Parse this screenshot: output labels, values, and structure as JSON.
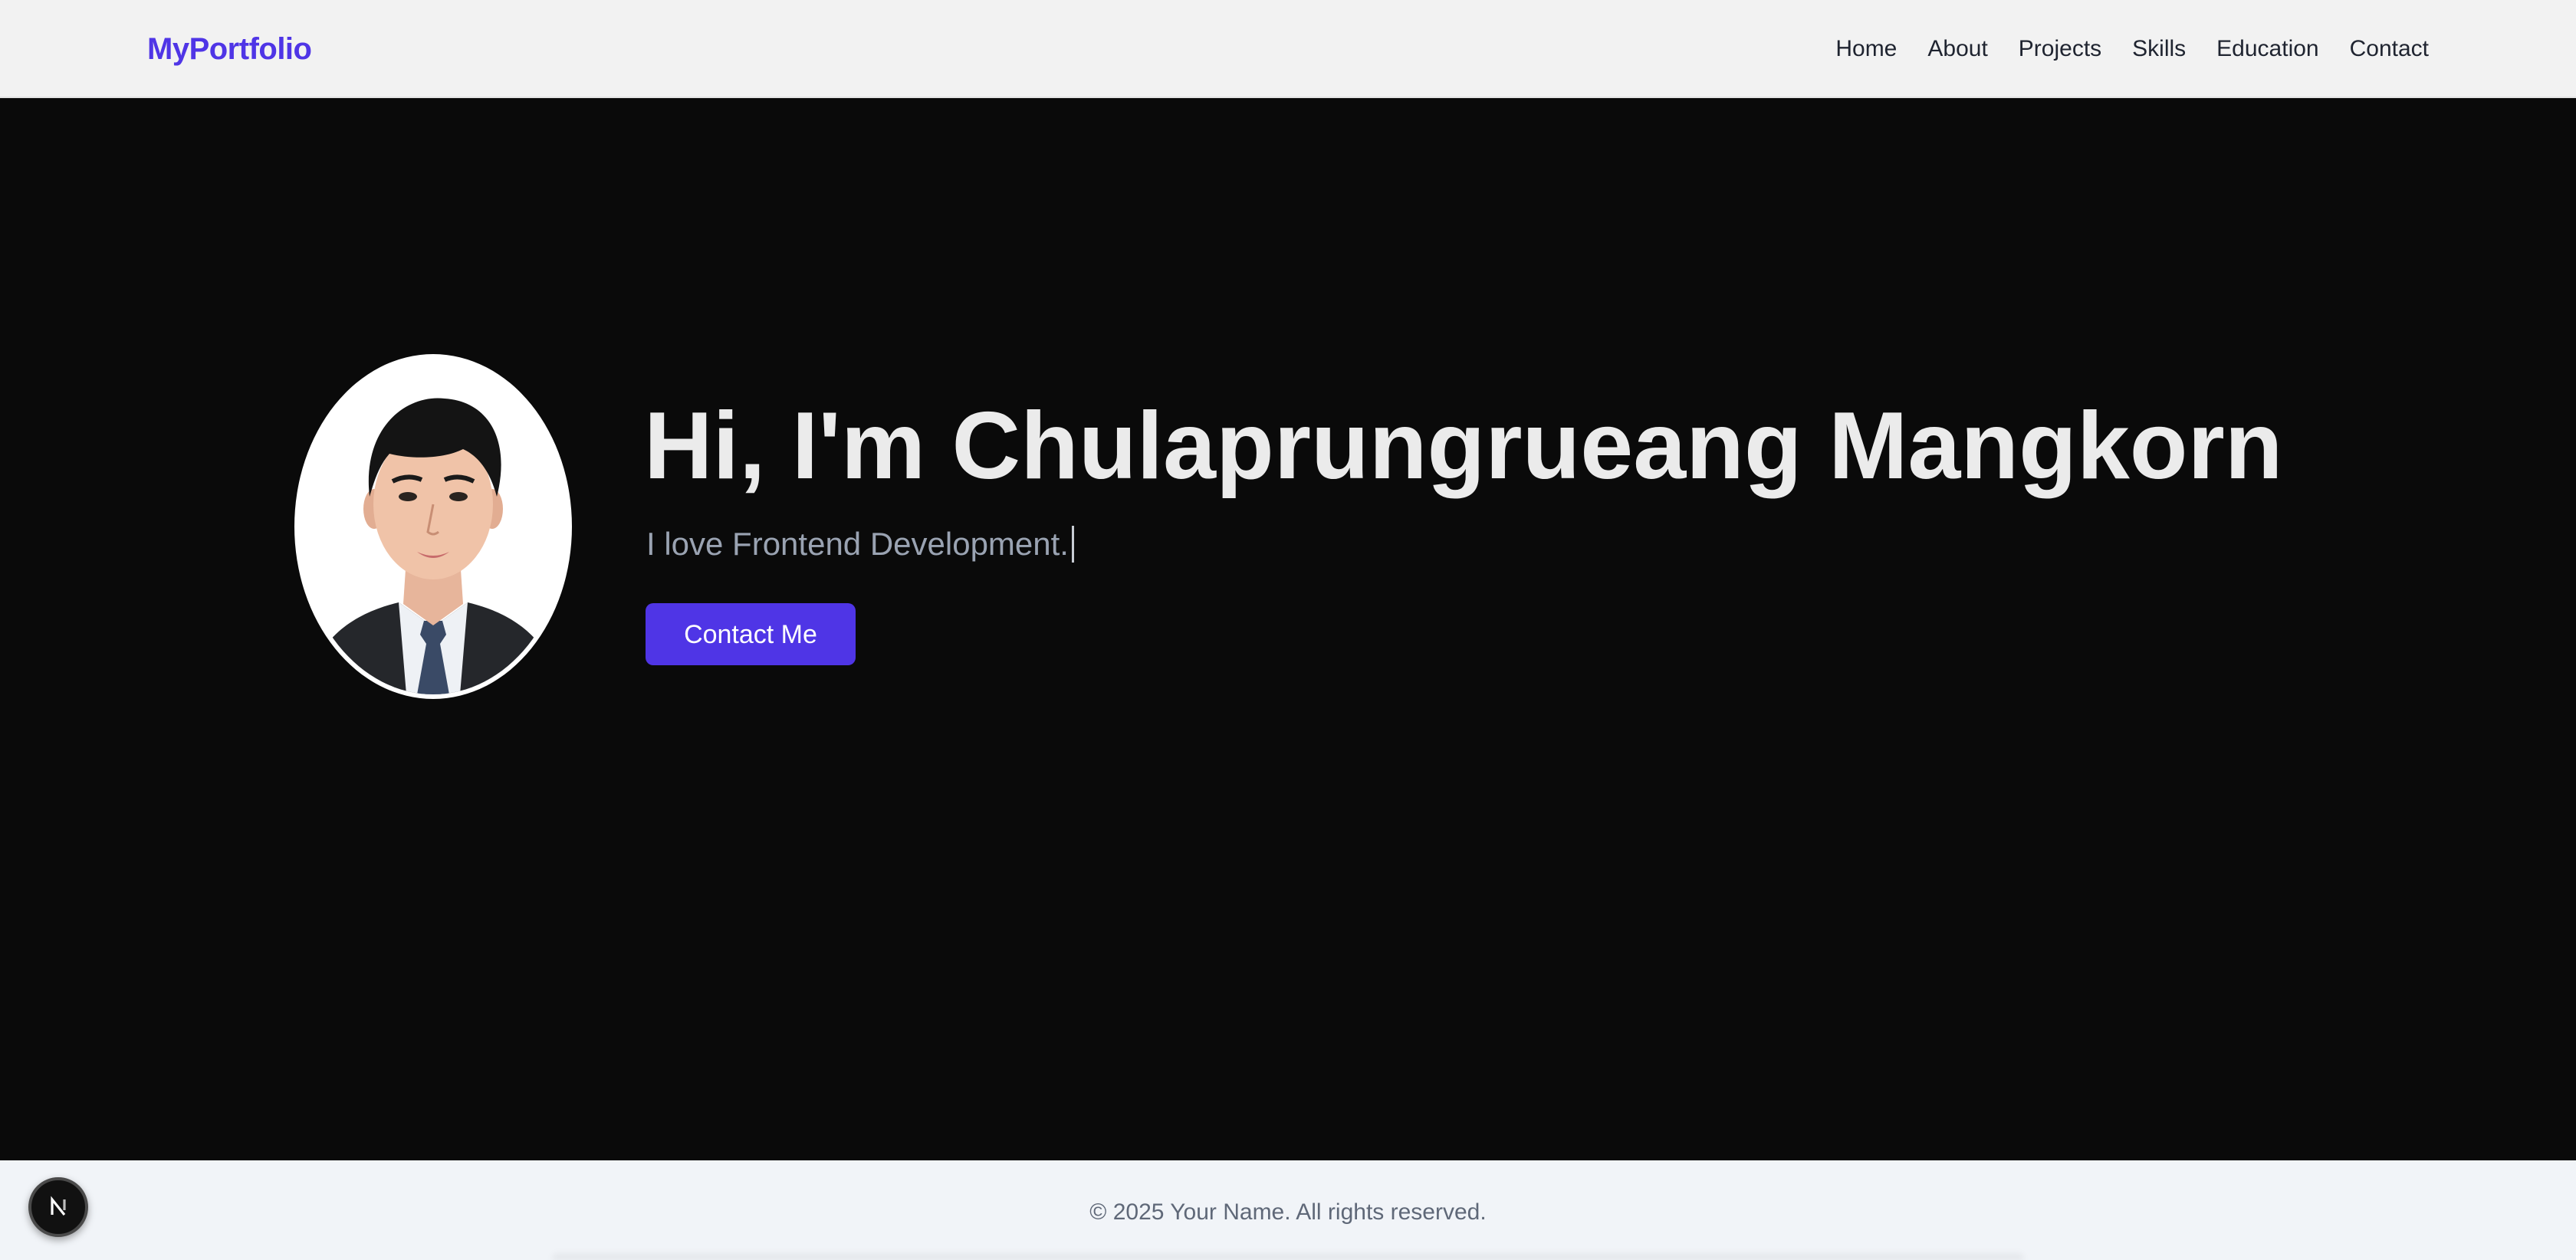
{
  "navbar": {
    "brand": "MyPortfolio",
    "links": [
      "Home",
      "About",
      "Projects",
      "Skills",
      "Education",
      "Contact"
    ]
  },
  "hero": {
    "title": "Hi, I'm Chulaprungrueang Mangkorn",
    "subtitle": "I love Frontend Development.",
    "cta_label": "Contact Me",
    "avatar_icon": "profile-photo"
  },
  "footer": {
    "text": "© 2025 Your Name. All rights reserved."
  },
  "dev_badge": {
    "icon": "nextjs-logo-icon",
    "letter": "N"
  },
  "colors": {
    "accent": "#4f35e6",
    "hero_bg": "#0a0a0a",
    "navbar_bg": "#f2f2f2",
    "footer_bg": "#f1f4f8"
  }
}
